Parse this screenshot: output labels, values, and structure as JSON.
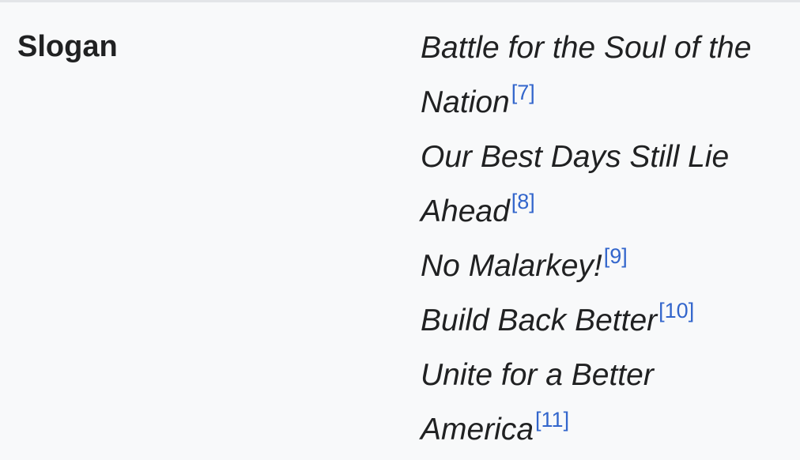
{
  "infobox": {
    "label": "Slogan",
    "slogans": [
      {
        "text": "Battle for the Soul of the Nation",
        "ref": "[7]"
      },
      {
        "text": "Our Best Days Still Lie Ahead",
        "ref": "[8]"
      },
      {
        "text": "No Malarkey!",
        "ref": "[9]"
      },
      {
        "text": "Build Back Better",
        "ref": "[10]"
      },
      {
        "text": "Unite for a Better America",
        "ref": "[11]"
      }
    ]
  },
  "colors": {
    "background": "#f8f9fa",
    "text": "#202122",
    "link": "#3366cc"
  }
}
